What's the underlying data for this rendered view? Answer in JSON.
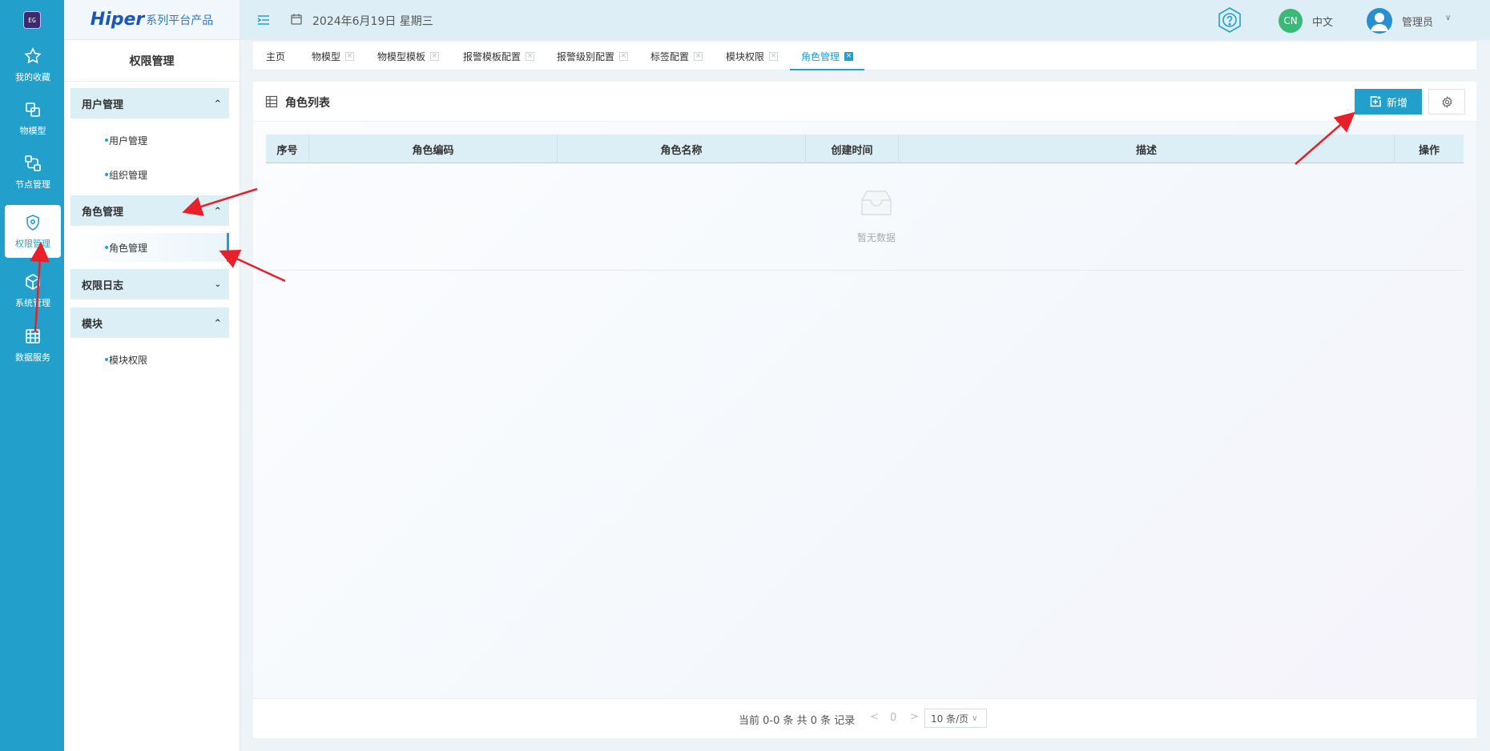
{
  "rail": {
    "logo_text": "EG",
    "items": [
      {
        "label": "我的收藏",
        "icon": "star-icon"
      },
      {
        "label": "物模型",
        "icon": "model-icon"
      },
      {
        "label": "节点管理",
        "icon": "node-icon"
      },
      {
        "label": "权限管理",
        "icon": "shield-icon",
        "active": true
      },
      {
        "label": "系统管理",
        "icon": "cube-icon"
      },
      {
        "label": "数据服务",
        "icon": "data-icon"
      }
    ]
  },
  "brand": {
    "main": "Hiper",
    "sub": "系列平台产品"
  },
  "subnav": {
    "title": "权限管理",
    "groups": [
      {
        "label": "用户管理",
        "items": [
          "用户管理",
          "组织管理"
        ]
      },
      {
        "label": "角色管理",
        "items": [
          "角色管理"
        ]
      },
      {
        "label": "权限日志",
        "items": []
      },
      {
        "label": "模块",
        "items": [
          "模块权限"
        ]
      }
    ]
  },
  "header": {
    "date": "2024年6月19日 星期三",
    "lang_badge": "CN",
    "lang": "中文",
    "user": "管理员"
  },
  "tabs": [
    "主页",
    "物模型",
    "物模型模板",
    "报警模板配置",
    "报警级别配置",
    "标签配置",
    "模块权限",
    "角色管理"
  ],
  "panel": {
    "title": "角色列表",
    "add_label": "新增",
    "columns": [
      "序号",
      "角色编码",
      "角色名称",
      "创建时间",
      "描述",
      "操作"
    ],
    "empty_text": "暂无数据"
  },
  "pagination": {
    "summary": "当前 0-0 条 共 0 条 记录",
    "page": "0",
    "page_size": "10 条/页"
  },
  "colors": {
    "accent": "#22a0cb",
    "annotation": "#e8202a"
  }
}
